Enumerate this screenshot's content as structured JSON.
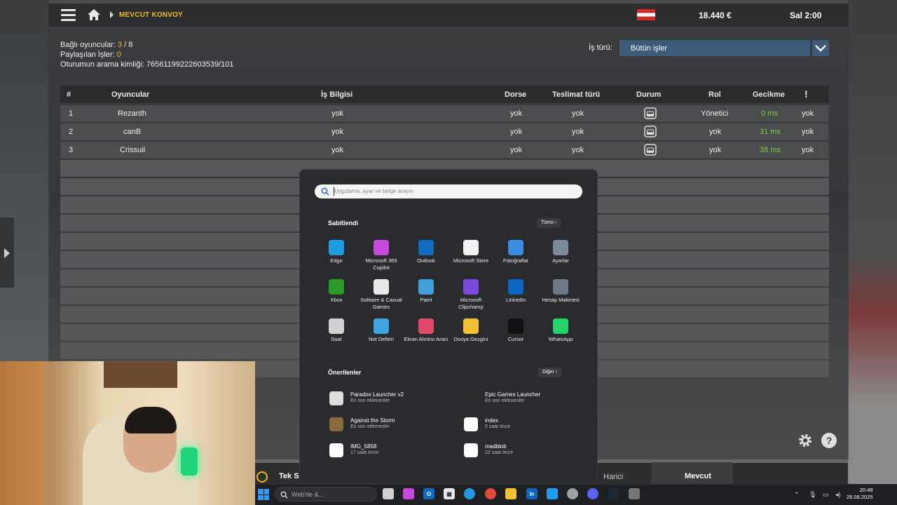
{
  "game": {
    "breadcrumb": "MEVCUT KONVOY",
    "money": "18.440 €",
    "time": "Sal 2:00",
    "info": {
      "connected_label": "Bağlı oyuncular:",
      "connected_value": "3",
      "connected_max": "/ 8",
      "shared_label": "Paylaşılan İşler:",
      "shared_value": "0",
      "session_label": "Oturumun arama kimliği:",
      "session_value": "76561199222603539/101"
    },
    "job_type_label": "İş türü:",
    "job_type_value": "Bütün işler",
    "table": {
      "headers": [
        "#",
        "Oyuncular",
        "İş Bilgisi",
        "Dorse",
        "Teslimat türü",
        "Durum",
        "Rol",
        "Gecikme",
        "!"
      ],
      "rows": [
        {
          "n": "1",
          "player": "Rezanth",
          "job": "yok",
          "trailer": "yok",
          "delivery": "yok",
          "role": "Yönetici",
          "ping": "0 ms",
          "flag": "yok"
        },
        {
          "n": "2",
          "player": "canB",
          "job": "yok",
          "trailer": "yok",
          "delivery": "yok",
          "role": "yok",
          "ping": "31 ms",
          "flag": "yok"
        },
        {
          "n": "3",
          "player": "Crissuil",
          "job": "yok",
          "trailer": "yok",
          "delivery": "yok",
          "role": "yok",
          "ping": "38 ms",
          "flag": "yok"
        }
      ]
    },
    "bottom": {
      "tek": "Tek S",
      "harici": "Harici",
      "mevcut": "Mevcut"
    },
    "help": "?"
  },
  "start_menu": {
    "search_placeholder": "Uygulama, ayar ve belge arayın",
    "pinned_title": "Sabitlendi",
    "all_button": "Tümü",
    "pinned": [
      {
        "label": "Edge",
        "icon": "edge-icon",
        "color": "#1f9be0"
      },
      {
        "label": "Microsoft 365 Copilot",
        "icon": "copilot-icon",
        "color": "#c54ad8"
      },
      {
        "label": "Outlook",
        "icon": "outlook-icon",
        "color": "#0f6cbd"
      },
      {
        "label": "Microsoft Store",
        "icon": "store-icon",
        "color": "#f0f0f0"
      },
      {
        "label": "Fotoğraflar",
        "icon": "photos-icon",
        "color": "#3b8be0"
      },
      {
        "label": "Ayarlar",
        "icon": "settings-icon",
        "color": "#7a8a9a"
      },
      {
        "label": "Xbox",
        "icon": "xbox-icon",
        "color": "#2a9a2a"
      },
      {
        "label": "Solitaire & Casual Games",
        "icon": "solitaire-icon",
        "color": "#e8e8e8"
      },
      {
        "label": "Paint",
        "icon": "paint-icon",
        "color": "#3fa0d8"
      },
      {
        "label": "Microsoft Clipchamp",
        "icon": "clipchamp-icon",
        "color": "#7a4ad8"
      },
      {
        "label": "LinkedIn",
        "icon": "linkedin-icon",
        "color": "#0a66c2"
      },
      {
        "label": "Hesap Makinesi",
        "icon": "calculator-icon",
        "color": "#6e7a88"
      },
      {
        "label": "Saat",
        "icon": "clock-icon",
        "color": "#d0d0d0"
      },
      {
        "label": "Not Defteri",
        "icon": "notepad-icon",
        "color": "#3fa4e0"
      },
      {
        "label": "Ekran Alıntısı Aracı",
        "icon": "snipping-tool-icon",
        "color": "#e04a6a"
      },
      {
        "label": "Dosya Gezgini",
        "icon": "file-explorer-icon",
        "color": "#f2c230"
      },
      {
        "label": "Cursor",
        "icon": "cursor-app-icon",
        "color": "#111111"
      },
      {
        "label": "WhatsApp",
        "icon": "whatsapp-icon",
        "color": "#25d366"
      }
    ],
    "recommended_title": "Önerilenler",
    "more_button": "Diğer",
    "recommended": [
      {
        "title": "Paradox Launcher v2",
        "sub": "En son eklenenler",
        "icon": "paradox-icon",
        "color": "#dddddd"
      },
      {
        "title": "Epic Games Launcher",
        "sub": "En son eklenenler",
        "icon": "epic-icon",
        "color": "#2a2a2a"
      },
      {
        "title": "Against the Storm",
        "sub": "En son eklenenler",
        "icon": "against-the-storm-icon",
        "color": "#8a6a3a"
      },
      {
        "title": "index",
        "sub": "5 saat önce",
        "icon": "chrome-doc-icon",
        "color": "#ffffff"
      },
      {
        "title": "IMG_5858",
        "sub": "17 saat önce",
        "icon": "image-file-icon",
        "color": "#ffffff"
      },
      {
        "title": "madblob",
        "sub": "22 saat önce",
        "icon": "chrome-doc-icon",
        "color": "#ffffff"
      }
    ]
  },
  "taskbar": {
    "search_placeholder": "Web'de &...",
    "time": "20:48",
    "date": "26.08.2025"
  }
}
